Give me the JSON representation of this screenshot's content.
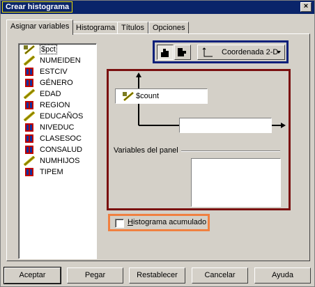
{
  "window": {
    "title": "Crear histograma",
    "close_label": "×"
  },
  "tabs": [
    {
      "label": "Asignar variables",
      "active": true
    },
    {
      "label": "Histograma",
      "active": false
    },
    {
      "label": "Títulos",
      "active": false
    },
    {
      "label": "Opciones",
      "active": false
    }
  ],
  "variables": [
    {
      "name": "$pct",
      "type": "scale-icon"
    },
    {
      "name": "NUMEIDEN",
      "type": "ruler-icon"
    },
    {
      "name": "ESTCIV",
      "type": "nominal-icon"
    },
    {
      "name": "GÉNERO",
      "type": "nominal-icon"
    },
    {
      "name": "EDAD",
      "type": "ruler-icon"
    },
    {
      "name": "REGION",
      "type": "nominal-icon"
    },
    {
      "name": "EDUCAÑOS",
      "type": "ruler-icon"
    },
    {
      "name": "NIVEDUC",
      "type": "nominal-icon"
    },
    {
      "name": "CLASESOC",
      "type": "nominal-icon"
    },
    {
      "name": "CONSALUD",
      "type": "nominal-icon"
    },
    {
      "name": "NUMHIJOS",
      "type": "ruler-icon"
    },
    {
      "name": "TIPEM",
      "type": "nominal-icon"
    }
  ],
  "toolbar": {
    "coordinate_label": "Coordenada 2-D"
  },
  "axes": {
    "y_value": "$count",
    "x_value": "",
    "panel_label": "Variables del panel"
  },
  "options": {
    "cumulative_label": "Histograma acumulado",
    "cumulative_checked": false
  },
  "buttons": {
    "accept": "Aceptar",
    "paste": "Pegar",
    "reset": "Restablecer",
    "cancel": "Cancelar",
    "help": "Ayuda"
  },
  "colors": {
    "titlebar": "#0a246a",
    "toolbar_frame": "#0a1f7a",
    "axes_frame": "#7a1010",
    "option_frame": "#f08040",
    "nominal_icon": "#c00000"
  }
}
